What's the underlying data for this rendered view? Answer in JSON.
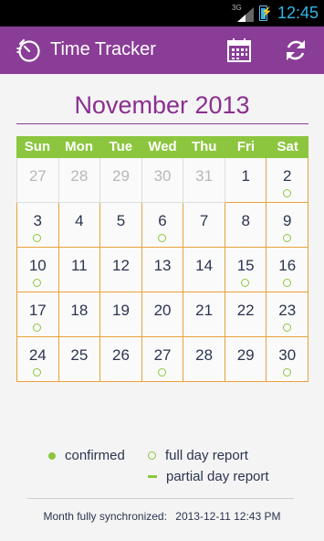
{
  "status_bar": {
    "network": "3G",
    "time": "12:45"
  },
  "toolbar": {
    "title": "Time Tracker",
    "calendar_icon": "calendar-icon",
    "sync_icon": "sync-icon",
    "accent": "#8a3d97"
  },
  "calendar": {
    "month_title": "November 2013",
    "weekdays": [
      "Sun",
      "Mon",
      "Tue",
      "Wed",
      "Thu",
      "Fri",
      "Sat"
    ],
    "weeks": [
      [
        {
          "day": "27",
          "in_month": false,
          "report": null
        },
        {
          "day": "28",
          "in_month": false,
          "report": null
        },
        {
          "day": "29",
          "in_month": false,
          "report": null
        },
        {
          "day": "30",
          "in_month": false,
          "report": null
        },
        {
          "day": "31",
          "in_month": false,
          "report": null
        },
        {
          "day": "1",
          "in_month": true,
          "report": null
        },
        {
          "day": "2",
          "in_month": true,
          "report": "full"
        }
      ],
      [
        {
          "day": "3",
          "in_month": true,
          "report": "full"
        },
        {
          "day": "4",
          "in_month": true,
          "report": null
        },
        {
          "day": "5",
          "in_month": true,
          "report": null
        },
        {
          "day": "6",
          "in_month": true,
          "report": "full"
        },
        {
          "day": "7",
          "in_month": true,
          "report": null
        },
        {
          "day": "8",
          "in_month": true,
          "report": null
        },
        {
          "day": "9",
          "in_month": true,
          "report": "full"
        }
      ],
      [
        {
          "day": "10",
          "in_month": true,
          "report": "full"
        },
        {
          "day": "11",
          "in_month": true,
          "report": null
        },
        {
          "day": "12",
          "in_month": true,
          "report": null
        },
        {
          "day": "13",
          "in_month": true,
          "report": null
        },
        {
          "day": "14",
          "in_month": true,
          "report": null
        },
        {
          "day": "15",
          "in_month": true,
          "report": "full"
        },
        {
          "day": "16",
          "in_month": true,
          "report": "full"
        }
      ],
      [
        {
          "day": "17",
          "in_month": true,
          "report": "full"
        },
        {
          "day": "18",
          "in_month": true,
          "report": null
        },
        {
          "day": "19",
          "in_month": true,
          "report": null
        },
        {
          "day": "20",
          "in_month": true,
          "report": null
        },
        {
          "day": "21",
          "in_month": true,
          "report": null
        },
        {
          "day": "22",
          "in_month": true,
          "report": null
        },
        {
          "day": "23",
          "in_month": true,
          "report": "full"
        }
      ],
      [
        {
          "day": "24",
          "in_month": true,
          "report": "full"
        },
        {
          "day": "25",
          "in_month": true,
          "report": null
        },
        {
          "day": "26",
          "in_month": true,
          "report": null
        },
        {
          "day": "27",
          "in_month": true,
          "report": "full"
        },
        {
          "day": "28",
          "in_month": true,
          "report": null
        },
        {
          "day": "29",
          "in_month": true,
          "report": null
        },
        {
          "day": "30",
          "in_month": true,
          "report": "full"
        }
      ]
    ],
    "colors": {
      "header": "#8cc63f",
      "border": "#e8a23a",
      "marker": "#8cc63f"
    }
  },
  "legend": {
    "confirmed": "confirmed",
    "full": "full day report",
    "partial": "partial day report"
  },
  "footer": {
    "sync_label": "Month fully synchronized:",
    "sync_time": "2013-12-11 12:43 PM"
  }
}
